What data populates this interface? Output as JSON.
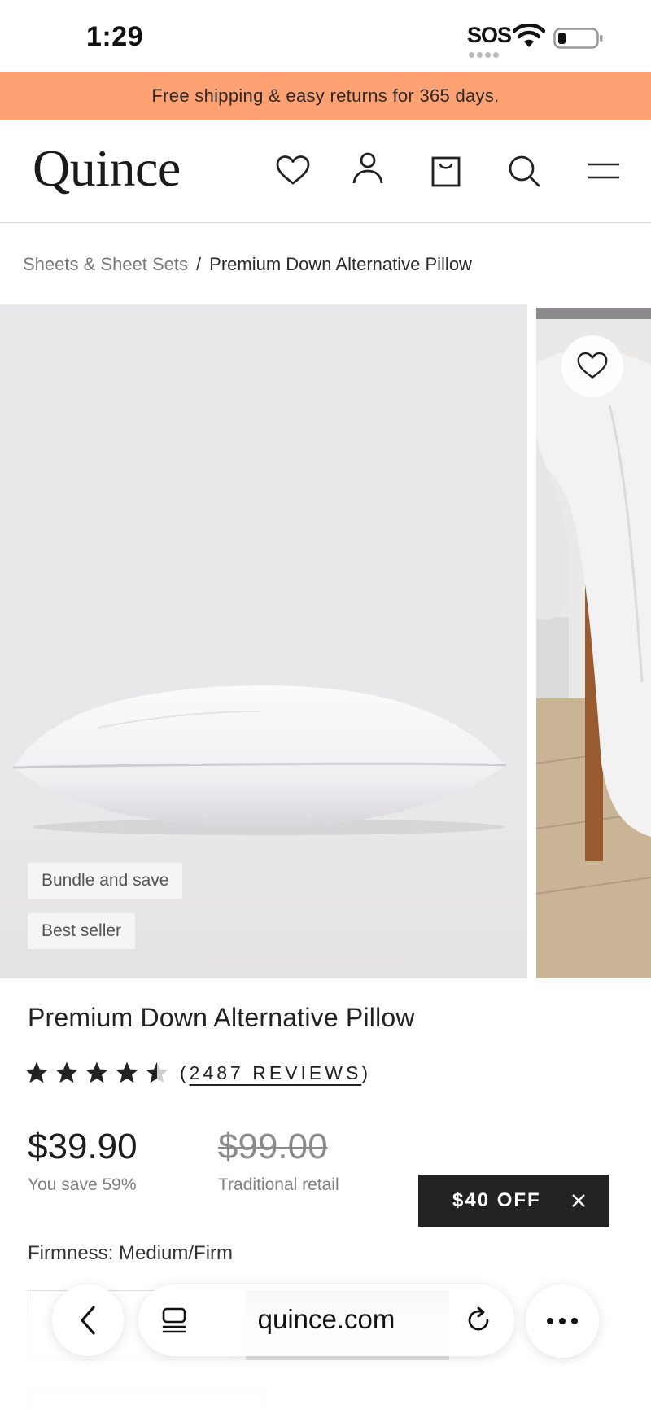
{
  "status_bar": {
    "time": "1:29",
    "sos": "SOS",
    "icons": [
      "wifi-icon",
      "battery-icon"
    ]
  },
  "promo_banner": {
    "text": "Free shipping & easy returns for 365 days.",
    "color": "#ffa273"
  },
  "header": {
    "logo": "Quince",
    "icons": [
      "heart-icon",
      "account-icon",
      "bag-icon",
      "search-icon",
      "menu-icon"
    ]
  },
  "breadcrumb": {
    "parent": "Sheets & Sheet Sets",
    "separator": "/",
    "current": "Premium Down Alternative Pillow"
  },
  "gallery": {
    "badges": [
      "Bundle and save",
      "Best seller"
    ],
    "icons": [
      "heart-icon"
    ]
  },
  "product": {
    "title": "Premium Down Alternative Pillow",
    "rating": 4.5,
    "rating_max": 5,
    "reviews_label": "2487 REVIEWS",
    "price": "$39.90",
    "savings": "You save 59%",
    "retail_price": "$99.00",
    "retail_label": "Traditional retail",
    "firmness_label": "Firmness: Medium/Firm"
  },
  "discount_tag": {
    "label": "$40 OFF",
    "icon": "close-icon"
  },
  "browser_bar": {
    "url": "quince.com",
    "icons": [
      "back-icon",
      "tabs-icon",
      "reload-icon",
      "more-icon"
    ]
  }
}
